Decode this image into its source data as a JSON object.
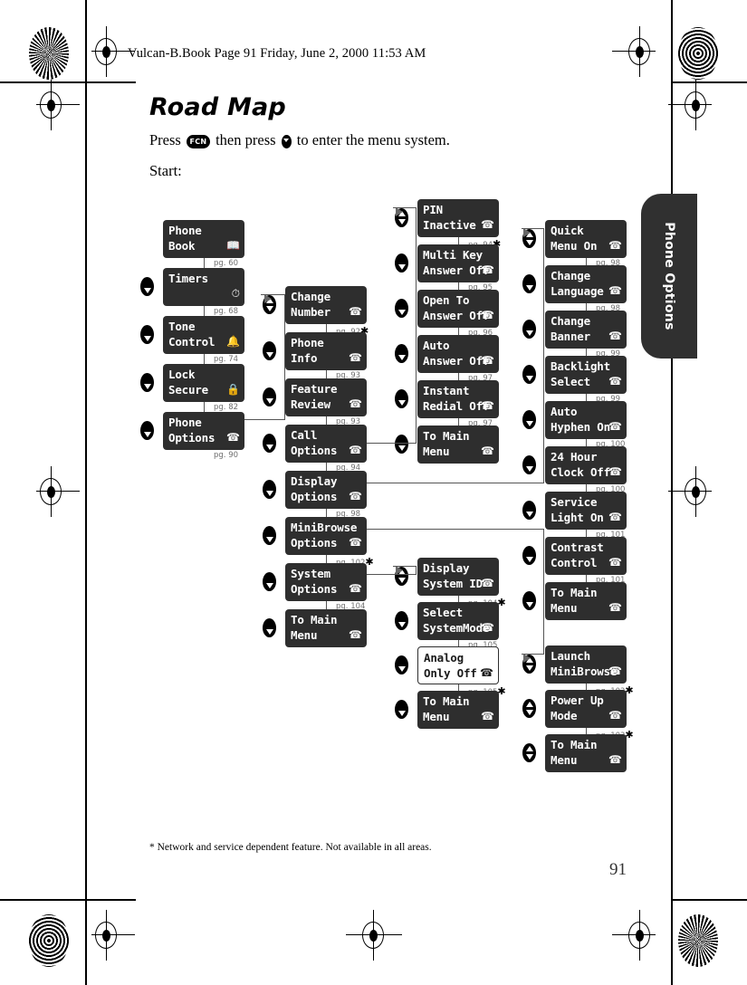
{
  "header": {
    "file_line": "Vulcan-B.Book  Page 91  Friday, June 2, 2000  11:53 AM"
  },
  "page": {
    "title": "Road Map",
    "intro_before_fcn": "Press",
    "fcn_key_label": "FCN",
    "intro_mid": "then press",
    "intro_after_nav": "to enter the menu system.",
    "start_label": "Start:",
    "footnote": "*  Network and service dependent feature. Not available in all areas.",
    "folio": "91",
    "thumb_tab": "Phone Options"
  },
  "icons": {
    "book": "book-icon",
    "stopwatch": "stopwatch-icon",
    "bell": "bell-icon",
    "lock": "lock-icon",
    "phone": "phone-icon",
    "nav_down": "nav-down-icon",
    "nav_updown": "nav-up-down-icon",
    "flow_arrow": "flow-arrow-icon"
  },
  "columns": {
    "main_menu": {
      "name": "Main Menu",
      "items": [
        {
          "line1": "Phone",
          "line2": "Book",
          "icon": "book",
          "page": "pg. 60",
          "asterisk": false,
          "nav": "none",
          "invert": false
        },
        {
          "line1": "Timers",
          "line2": "",
          "icon": "stopwatch",
          "page": "pg. 68",
          "asterisk": false,
          "nav": "down",
          "invert": false
        },
        {
          "line1": "Tone",
          "line2": "Control",
          "icon": "bell",
          "page": "pg. 74",
          "asterisk": false,
          "nav": "down",
          "invert": false
        },
        {
          "line1": "Lock",
          "line2": "Secure",
          "icon": "lock",
          "page": "pg. 82",
          "asterisk": false,
          "nav": "down",
          "invert": false
        },
        {
          "line1": "Phone",
          "line2": "Options",
          "icon": "phone",
          "page": "pg. 90",
          "asterisk": false,
          "nav": "down",
          "invert": false
        }
      ]
    },
    "phone_options": {
      "name": "Phone Options",
      "items": [
        {
          "line1": "Change",
          "line2": "Number",
          "icon": "phone",
          "page": "pg. 92",
          "asterisk": true,
          "nav": "updown",
          "invert": false
        },
        {
          "line1": "Phone",
          "line2": "Info",
          "icon": "phone",
          "page": "pg. 93",
          "asterisk": false,
          "nav": "down",
          "invert": false
        },
        {
          "line1": "Feature",
          "line2": "Review",
          "icon": "phone",
          "page": "pg. 93",
          "asterisk": false,
          "nav": "down",
          "invert": false
        },
        {
          "line1": "Call",
          "line2": "Options",
          "icon": "phone",
          "page": "pg. 94",
          "asterisk": false,
          "nav": "down",
          "invert": false
        },
        {
          "line1": "Display",
          "line2": "Options",
          "icon": "phone",
          "page": "pg. 98",
          "asterisk": false,
          "nav": "down",
          "invert": false
        },
        {
          "line1": "MiniBrowse",
          "line2": "Options",
          "icon": "phone",
          "page": "pg. 102",
          "asterisk": true,
          "nav": "down",
          "invert": false
        },
        {
          "line1": "System",
          "line2": "Options",
          "icon": "phone",
          "page": "pg. 104",
          "asterisk": false,
          "nav": "down",
          "invert": false
        },
        {
          "line1": "To Main",
          "line2": "Menu",
          "icon": "phone",
          "page": "",
          "asterisk": false,
          "nav": "down",
          "invert": false
        }
      ]
    },
    "call_options": {
      "name": "Call Options",
      "items": [
        {
          "line1": "PIN",
          "line2": "Inactive",
          "icon": "phone",
          "page": "pg. 94",
          "asterisk": true,
          "nav": "updown",
          "invert": false
        },
        {
          "line1": "Multi Key",
          "line2": "Answer Off",
          "icon": "phone",
          "page": "pg. 95",
          "asterisk": false,
          "nav": "down",
          "invert": false
        },
        {
          "line1": "Open To",
          "line2": "Answer Off",
          "icon": "phone",
          "page": "pg. 96",
          "asterisk": false,
          "nav": "down",
          "invert": false
        },
        {
          "line1": "Auto",
          "line2": "Answer Off",
          "icon": "phone",
          "page": "pg. 97",
          "asterisk": false,
          "nav": "down",
          "invert": false
        },
        {
          "line1": "Instant",
          "line2": "Redial Off",
          "icon": "phone",
          "page": "pg. 97",
          "asterisk": false,
          "nav": "down",
          "invert": false
        },
        {
          "line1": "To Main",
          "line2": "Menu",
          "icon": "phone",
          "page": "",
          "asterisk": false,
          "nav": "down",
          "invert": false
        }
      ]
    },
    "system_options": {
      "name": "System Options",
      "items": [
        {
          "line1": "Display",
          "line2": "System ID",
          "icon": "phone",
          "page": "pg. 104",
          "asterisk": true,
          "nav": "updown",
          "invert": false
        },
        {
          "line1": "Select",
          "line2": "SystemMode",
          "icon": "phone",
          "page": "pg. 105",
          "asterisk": false,
          "nav": "down",
          "invert": false
        },
        {
          "line1": "Analog",
          "line2": "Only Off",
          "icon": "phone",
          "page": "pg. 105",
          "asterisk": true,
          "nav": "down",
          "invert": true
        },
        {
          "line1": "To Main",
          "line2": "Menu",
          "icon": "phone",
          "page": "",
          "asterisk": false,
          "nav": "down",
          "invert": false
        }
      ]
    },
    "display_options": {
      "name": "Display Options",
      "items": [
        {
          "line1": "Quick",
          "line2": "Menu On",
          "icon": "phone",
          "page": "pg. 98",
          "asterisk": false,
          "nav": "updown",
          "invert": false
        },
        {
          "line1": "Change",
          "line2": "Language",
          "icon": "phone",
          "page": "pg. 98",
          "asterisk": false,
          "nav": "down",
          "invert": false
        },
        {
          "line1": "Change",
          "line2": "Banner",
          "icon": "phone",
          "page": "pg. 99",
          "asterisk": false,
          "nav": "down",
          "invert": false
        },
        {
          "line1": "Backlight",
          "line2": "Select",
          "icon": "phone",
          "page": "pg. 99",
          "asterisk": false,
          "nav": "down",
          "invert": false
        },
        {
          "line1": "Auto",
          "line2": "Hyphen On",
          "icon": "phone",
          "page": "pg. 100",
          "asterisk": false,
          "nav": "down",
          "invert": false
        },
        {
          "line1": "24 Hour",
          "line2": "Clock Off",
          "icon": "phone",
          "page": "pg. 100",
          "asterisk": false,
          "nav": "down",
          "invert": false
        },
        {
          "line1": "Service",
          "line2": "Light On",
          "icon": "phone",
          "page": "pg. 101",
          "asterisk": false,
          "nav": "down",
          "invert": false
        },
        {
          "line1": "Contrast",
          "line2": "Control",
          "icon": "phone",
          "page": "pg. 101",
          "asterisk": false,
          "nav": "down",
          "invert": false
        },
        {
          "line1": "To Main",
          "line2": "Menu",
          "icon": "phone",
          "page": "",
          "asterisk": false,
          "nav": "down",
          "invert": false
        }
      ]
    },
    "minibrowse_options": {
      "name": "MiniBrowse Options",
      "items": [
        {
          "line1": "Launch",
          "line2": "MiniBrowse",
          "icon": "phone",
          "page": "pg. 102",
          "asterisk": true,
          "nav": "updown",
          "invert": false
        },
        {
          "line1": "Power Up",
          "line2": "Mode",
          "icon": "phone",
          "page": "pg. 103",
          "asterisk": true,
          "nav": "updown",
          "invert": false
        },
        {
          "line1": "To Main",
          "line2": "Menu",
          "icon": "phone",
          "page": "",
          "asterisk": false,
          "nav": "updown",
          "invert": false
        }
      ]
    }
  }
}
